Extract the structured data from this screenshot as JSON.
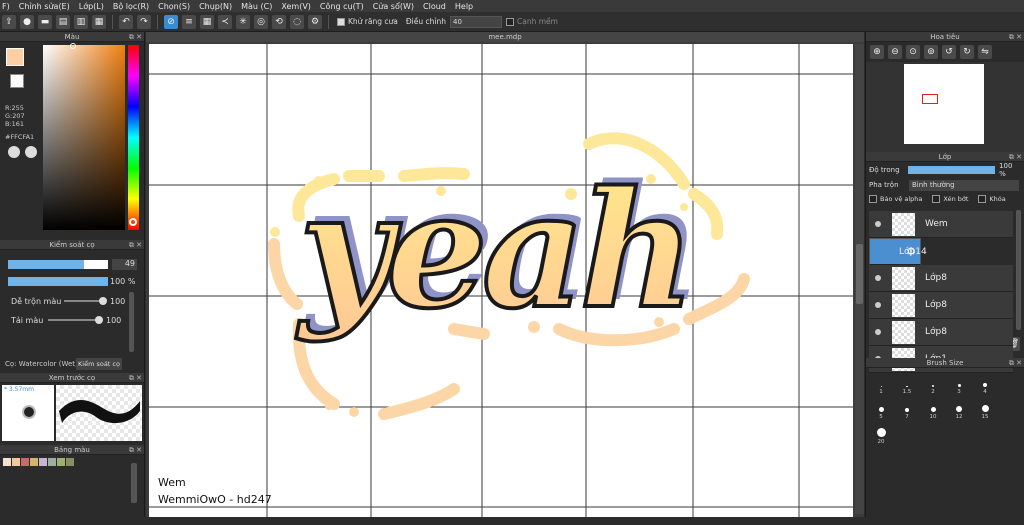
{
  "menu": [
    "F)",
    "Chỉnh sửa(E)",
    "Lớp(L)",
    "Bộ lọc(R)",
    "Chọn(S)",
    "Chụp(N)",
    "Màu (C)",
    "Xem(V)",
    "Công cụ(T)",
    "Cửa sổ(W)",
    "Cloud",
    "Help"
  ],
  "toolbar": {
    "antialias_label": "Khử răng cưa",
    "adjust_label": "Điều chỉnh",
    "adjust_value": "40",
    "edge_label": "Cạnh mềm"
  },
  "color_panel": {
    "title": "Màu",
    "r": "R:255",
    "g": "G:207",
    "b": "B:161",
    "hex": "#FFCFA1",
    "current_color": "#ffcfa1"
  },
  "brush_control": {
    "title": "Kiểm soát cọ",
    "size_value": "49",
    "opacity_value": "100 %",
    "blend_label": "Dễ trộn màu",
    "blend_value": "100",
    "load_label": "Tải màu",
    "load_value": "100",
    "brush_name": "Cọ: Watercolor (Wet)",
    "tab_label": "Kiểm soát cọ"
  },
  "preview": {
    "title": "Xem trước cọ",
    "size_text": "* 3.57mm"
  },
  "palette": {
    "title": "Bảng màu",
    "colors": [
      "#f6e0cf",
      "#f3c89c",
      "#c86a6a",
      "#d2b46e",
      "#c8b4d4",
      "#9ab0a0",
      "#a0b070",
      "#889060"
    ]
  },
  "document": {
    "tab_title": "mee.mdp",
    "caption_line1": "Wem",
    "caption_line2": "WemmiOwO - hd247",
    "artwork_text": "yeah"
  },
  "navigator": {
    "title": "Hoa tiêu"
  },
  "layers": {
    "title": "Lớp",
    "opacity_label": "Độ trong",
    "opacity_value": "100 %",
    "blend_label": "Pha trộn",
    "blend_value": "Bình thường",
    "protect_alpha": "Bảo vệ alpha",
    "clip": "Xén bớt",
    "lock": "Khóa",
    "items": [
      {
        "name": "Wem"
      },
      {
        "name": "Lớp14"
      },
      {
        "name": "Lớp8"
      },
      {
        "name": "Lớp8"
      },
      {
        "name": "Lớp8"
      },
      {
        "name": "Lớp1"
      }
    ]
  },
  "brush_size": {
    "title": "Brush Size",
    "labels": [
      "1",
      "1.5",
      "2",
      "3",
      "4",
      "5",
      "7",
      "10",
      "12",
      "15",
      "20"
    ]
  },
  "colors": {
    "accent": "#3c8bd0",
    "fill_top": "#ffe98a",
    "fill_bottom": "#ffc896",
    "shadow": "#8f93c8",
    "halo": "#fde89a",
    "halo2": "#fdd6a8"
  }
}
